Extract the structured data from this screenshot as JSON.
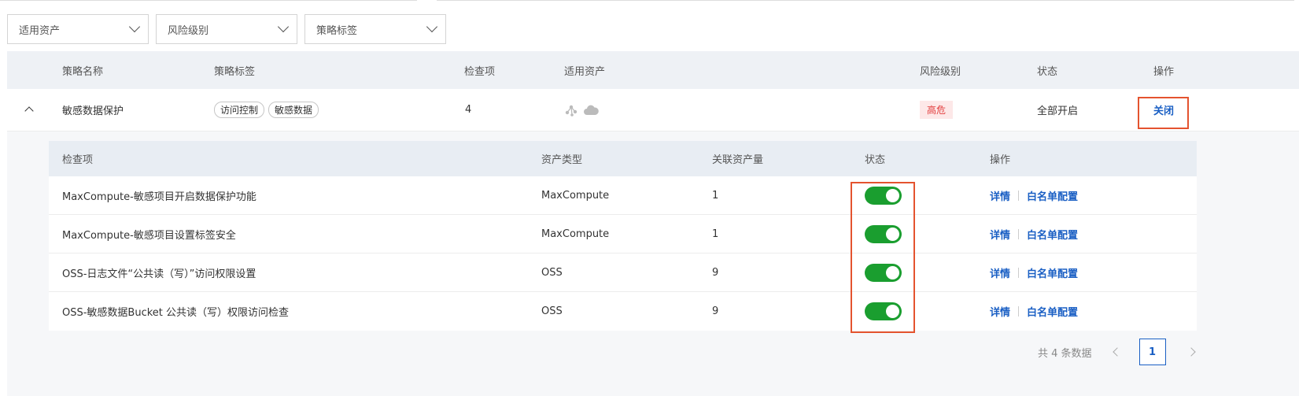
{
  "filters": [
    {
      "label": "适用资产"
    },
    {
      "label": "风险级别"
    },
    {
      "label": "策略标签"
    }
  ],
  "table": {
    "headers": {
      "name": "策略名称",
      "tags": "策略标签",
      "checks": "检查项",
      "assets": "适用资产",
      "risk": "风险级别",
      "status": "状态",
      "action": "操作"
    },
    "row": {
      "name": "敏感数据保护",
      "tags": [
        "访问控制",
        "敏感数据"
      ],
      "checks": "4",
      "asset_icons": [
        "graph-nodes-icon",
        "cloud-icon"
      ],
      "risk": "高危",
      "status": "全部开启",
      "action": "关闭"
    }
  },
  "sub_table": {
    "headers": {
      "check": "检查项",
      "asset_type": "资产类型",
      "count": "关联资产量",
      "status": "状态",
      "action": "操作"
    },
    "rows": [
      {
        "check": "MaxCompute-敏感项目开启数据保护功能",
        "asset_type": "MaxCompute",
        "count": "1",
        "enabled": true,
        "detail": "详情",
        "whitelist": "白名单配置"
      },
      {
        "check": "MaxCompute-敏感项目设置标签安全",
        "asset_type": "MaxCompute",
        "count": "1",
        "enabled": true,
        "detail": "详情",
        "whitelist": "白名单配置"
      },
      {
        "check": "OSS-日志文件“公共读（写）”访问权限设置",
        "asset_type": "OSS",
        "count": "9",
        "enabled": true,
        "detail": "详情",
        "whitelist": "白名单配置"
      },
      {
        "check": "OSS-敏感数据Bucket 公共读（写）权限访问检查",
        "asset_type": "OSS",
        "count": "9",
        "enabled": true,
        "detail": "详情",
        "whitelist": "白名单配置"
      }
    ]
  },
  "pagination": {
    "total_text": "共 4 条数据",
    "current_page": "1"
  },
  "colors": {
    "link": "#1a5fc4",
    "toggle_on": "#1a9e2f",
    "risk_high": "#e23c3c",
    "highlight": "#e4532f"
  }
}
